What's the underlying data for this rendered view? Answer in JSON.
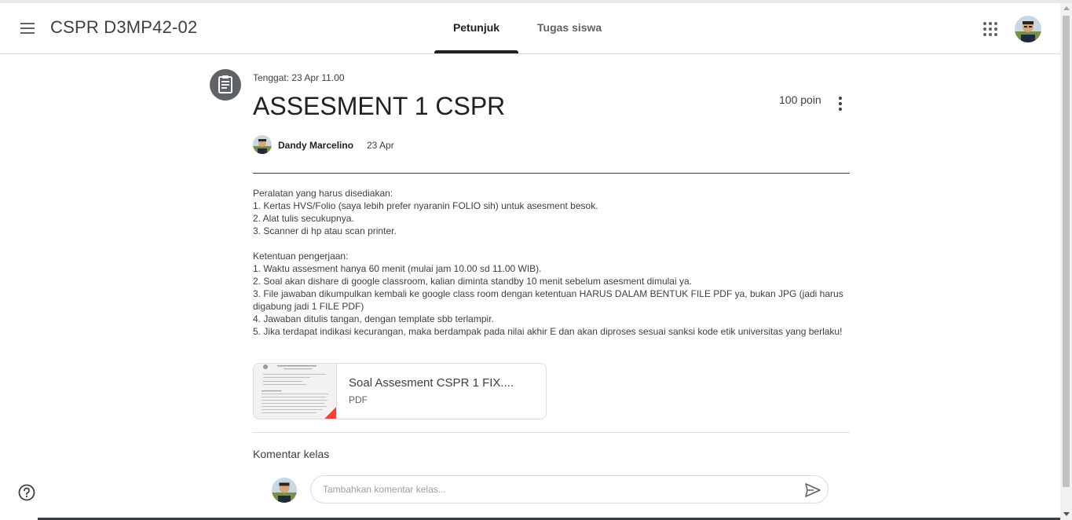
{
  "header": {
    "class_title": "CSPR D3MP42-02",
    "tabs": [
      {
        "label": "Petunjuk",
        "active": true
      },
      {
        "label": "Tugas siswa",
        "active": false
      }
    ]
  },
  "assignment": {
    "due": "Tenggat: 23 Apr 11.00",
    "title": "ASSESMENT 1 CSPR",
    "points": "100 poin",
    "author": "Dandy Marcelino",
    "posted": "23 Apr",
    "description": [
      "Peralatan yang harus disediakan:",
      "1. Kertas HVS/Folio (saya lebih prefer nyaranin FOLIO sih) untuk asesment besok.",
      "2. Alat tulis secukupnya.",
      "3. Scanner di hp atau scan printer.",
      "",
      "Ketentuan pengerjaan:",
      "1. Waktu assesment hanya 60 menit (mulai jam 10.00 sd 11.00 WIB).",
      "2. Soal akan dishare di google classroom, kalian diminta standby 10 menit sebelum asesment dimulai ya.",
      "3. File jawaban dikumpulkan kembali ke google class room dengan ketentuan HARUS DALAM BENTUK FILE PDF ya, bukan JPG (jadi harus digabung jadi 1 FILE PDF)",
      "4. Jawaban ditulis tangan, dengan template sbb terlampir.",
      "5. Jika terdapat indikasi kecurangan, maka berdampak pada nilai akhir E dan akan diproses sesuai sanksi kode etik universitas yang berlaku!"
    ],
    "attachment": {
      "name": "Soal Assesment CSPR 1 FIX....",
      "type": "PDF"
    }
  },
  "comments": {
    "label": "Komentar kelas",
    "placeholder": "Tambahkan komentar kelas..."
  },
  "icons": {
    "menu": "menu-icon",
    "apps": "apps-grid-icon",
    "assignment": "assignment-icon",
    "more": "more-vert-icon",
    "send": "send-icon",
    "help": "help-icon"
  },
  "colors": {
    "active_tab": "#202124",
    "assignment_icon_bg": "#5f6368",
    "pdf_accent": "#f44336"
  }
}
